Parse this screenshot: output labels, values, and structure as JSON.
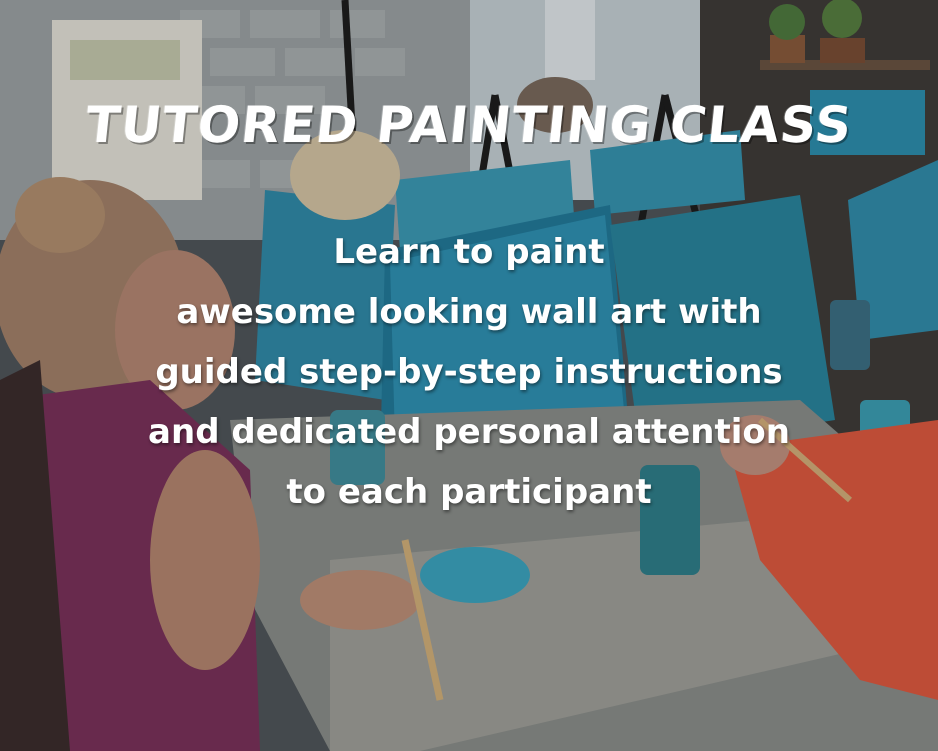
{
  "poster": {
    "title": "TUTORED PAINTING CLASS",
    "lines": [
      "Learn to paint",
      "awesome looking wall art with",
      "guided step-by-step instructions",
      "and dedicated personal attention",
      "to each participant"
    ]
  },
  "colors": {
    "text": "#ffffff",
    "canvas_teal": "#2a8fb0",
    "sweater_red": "#e2583e",
    "top_purple": "#7a2f5a"
  }
}
